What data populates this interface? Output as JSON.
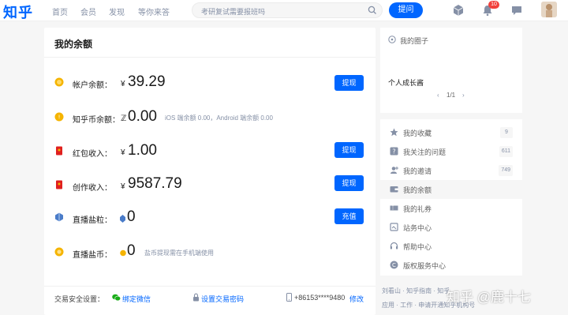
{
  "colors": {
    "accent": "#0066ff",
    "badge": "#f1403c",
    "coin": "#f5b400",
    "red_packet": "#e02020"
  },
  "topbar": {
    "logo": "知乎",
    "nav": [
      "首页",
      "会员",
      "发现",
      "等你来答"
    ],
    "search_placeholder": "考研复试需要报班吗",
    "ask_label": "提问",
    "notification_count": "10"
  },
  "wallet": {
    "title": "我的余额",
    "rows": [
      {
        "label": "帐户余额：",
        "currency": "¥",
        "amount": "39.29",
        "button": "提现",
        "icon": "coin-icon"
      },
      {
        "label": "知乎币余额：",
        "currency": "ℤ",
        "amount": "0.00",
        "note": "iOS 端余额 0.00，Android 端余额 0.00",
        "icon": "zhihu-coin-icon"
      },
      {
        "label": "红包收入：",
        "currency": "¥",
        "amount": "1.00",
        "button": "提现",
        "icon": "red-packet-icon"
      },
      {
        "label": "创作收入：",
        "currency": "¥",
        "amount": "9587.79",
        "button": "提现",
        "icon": "creation-income-icon"
      },
      {
        "label": "直播盐粒：",
        "amount": "0",
        "button": "充值",
        "icon": "salt-grain-icon"
      },
      {
        "label": "直播盐币：",
        "amount": "0",
        "note": "盐币提现需在手机端使用",
        "icon": "salt-coin-icon"
      }
    ],
    "security": {
      "label": "交易安全设置：",
      "wechat": "绑定微信",
      "password": "设置交易密码",
      "phone": "+86153****9480",
      "phone_action": "修改"
    }
  },
  "sidebar": {
    "circle_label": "我的圈子",
    "growth_label": "个人成长酱",
    "pager": "1/1",
    "items": [
      {
        "label": "我的收藏",
        "count": "9",
        "icon": "star-icon"
      },
      {
        "label": "我关注的问题",
        "count": "611",
        "icon": "question-icon"
      },
      {
        "label": "我的邀请",
        "count": "749",
        "icon": "invite-icon"
      },
      {
        "label": "我的余额",
        "icon": "wallet-icon",
        "active": true
      },
      {
        "label": "我的礼券",
        "icon": "coupon-icon"
      },
      {
        "label": "站务中心",
        "icon": "site-center-icon"
      },
      {
        "label": "帮助中心",
        "icon": "help-icon"
      },
      {
        "label": "版权服务中心",
        "icon": "copyright-icon"
      }
    ],
    "footer_line1": "刘看山 · 知乎指南 · 知乎",
    "footer_line2": "应用 · 工作 · 申请开通知乎机构号"
  },
  "watermark": "知乎 @鹿十七"
}
